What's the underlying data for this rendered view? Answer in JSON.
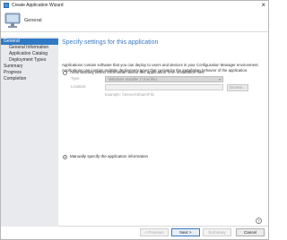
{
  "window": {
    "title": "Create Application Wizard"
  },
  "header": {
    "page": "General"
  },
  "nav": {
    "items": [
      {
        "label": "General",
        "level": 0,
        "active": true
      },
      {
        "label": "General Information",
        "level": 1
      },
      {
        "label": "Application Catalog",
        "level": 1
      },
      {
        "label": "Deployment Types",
        "level": 1
      },
      {
        "label": "Summary",
        "level": 0
      },
      {
        "label": "Progress",
        "level": 0
      },
      {
        "label": "Completion",
        "level": 0
      }
    ]
  },
  "content": {
    "heading": "Specify settings for this application",
    "description": "Applications contain software that you can deploy to users and devices in your Configuration Manager environment. Applications can contain multiple deployment types that customize the installation behavior of the application.",
    "auto_detect": {
      "label": "Automatically detect information about this application from installation files:",
      "selected": false,
      "type_label": "Type:",
      "type_value": "Windows Installer (*.msi file)",
      "location_label": "Location:",
      "location_value": "",
      "example": "Example: \\\\Server\\Share\\File",
      "browse_label": "Browse..."
    },
    "manual": {
      "label": "Manually specify the application information",
      "selected": true
    }
  },
  "footer": {
    "previous": "< Previous",
    "next": "Next >",
    "summary": "Summary",
    "cancel": "Cancel"
  },
  "colors": {
    "accent": "#2f79c5",
    "heading": "#3b79c2",
    "sidebar": "#e8eaee"
  }
}
